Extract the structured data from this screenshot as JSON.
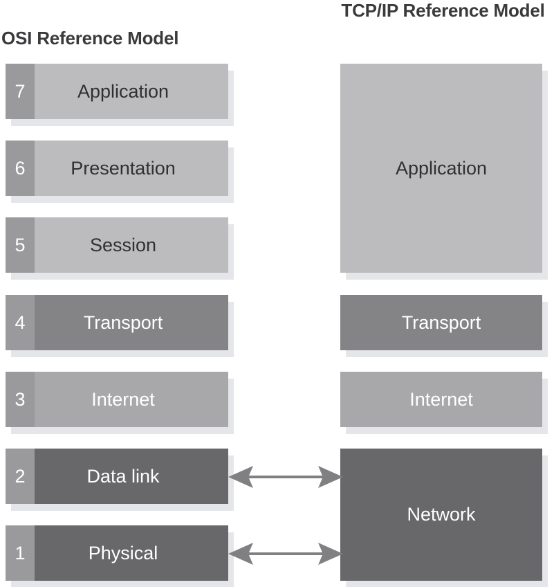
{
  "headings": {
    "osi": "OSI Reference Model",
    "tcpip": "TCP/IP Reference Model"
  },
  "colors": {
    "light_gray": "#BCBCBE",
    "mid_gray": "#A8A8AA",
    "dark_gray": "#848486",
    "darker_gray": "#68686A",
    "number_box_gray": "#9A9A9C",
    "shadow_gray": "#E5E6E9",
    "heading_text": "#3A3A3C",
    "arrow_gray": "#808083",
    "background": "#FFFFFF"
  },
  "osi_layers": [
    {
      "number": "7",
      "name": "Application",
      "tone": "light"
    },
    {
      "number": "6",
      "name": "Presentation",
      "tone": "light"
    },
    {
      "number": "5",
      "name": "Session",
      "tone": "light"
    },
    {
      "number": "4",
      "name": "Transport",
      "tone": "dark"
    },
    {
      "number": "3",
      "name": "Internet",
      "tone": "mid"
    },
    {
      "number": "2",
      "name": "Data link",
      "tone": "darker"
    },
    {
      "number": "1",
      "name": "Physical",
      "tone": "darker"
    }
  ],
  "tcpip_layers": [
    {
      "name": "Application",
      "tone": "light",
      "spans_osi": [
        "7",
        "6",
        "5"
      ]
    },
    {
      "name": "Transport",
      "tone": "dark",
      "spans_osi": [
        "4"
      ]
    },
    {
      "name": "Internet",
      "tone": "mid",
      "spans_osi": [
        "3"
      ]
    },
    {
      "name": "Network",
      "tone": "darker",
      "spans_osi": [
        "2",
        "1"
      ]
    }
  ],
  "connectors": [
    {
      "name": "data-link-to-network",
      "style": "double-headed-arrow",
      "from": "Data link",
      "to": "Network"
    },
    {
      "name": "physical-to-network",
      "style": "double-headed-arrow",
      "from": "Physical",
      "to": "Network"
    }
  ]
}
